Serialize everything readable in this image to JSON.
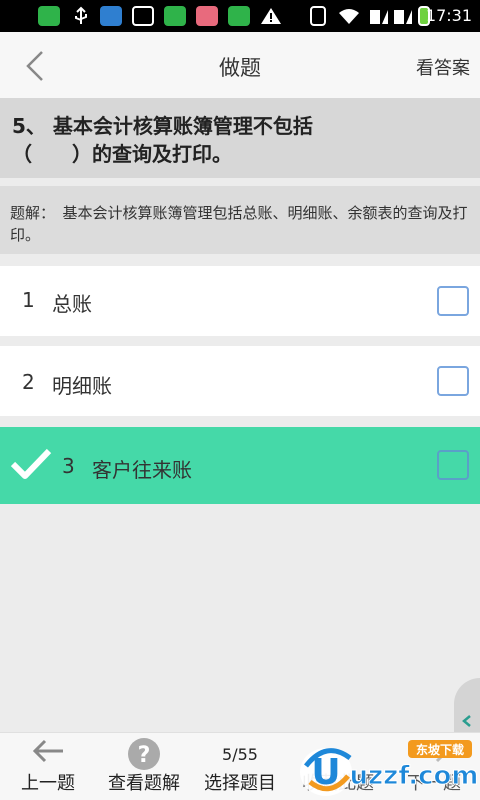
{
  "status_bar": {
    "time": "17:31"
  },
  "header": {
    "title": "做题",
    "answer_label": "看答案"
  },
  "question": {
    "text": "5、 基本会计核算账簿管理不包括（　　）的查询及打印。"
  },
  "explanation": {
    "text": "题解：　基本会计核算账簿管理包括总账、明细账、余额表的查询及打印。"
  },
  "options": [
    {
      "num": "1",
      "label": "总账",
      "selected": false
    },
    {
      "num": "2",
      "label": "明细账",
      "selected": false
    },
    {
      "num": "3",
      "label": "客户往来账",
      "selected": true
    }
  ],
  "toolbar": {
    "prev_label": "上一题",
    "view_explain_label": "查看题解",
    "progress": "5/55",
    "select_label": "选择题目",
    "favorite_label": "收藏此题",
    "next_label": "下一题"
  },
  "watermark": {
    "brand": "东坡下载",
    "site": "uzzf.com"
  },
  "colors": {
    "selected_option": "#45d9a8",
    "checkbox_border": "#7aa6df",
    "header_bg": "#f7f7f7"
  }
}
